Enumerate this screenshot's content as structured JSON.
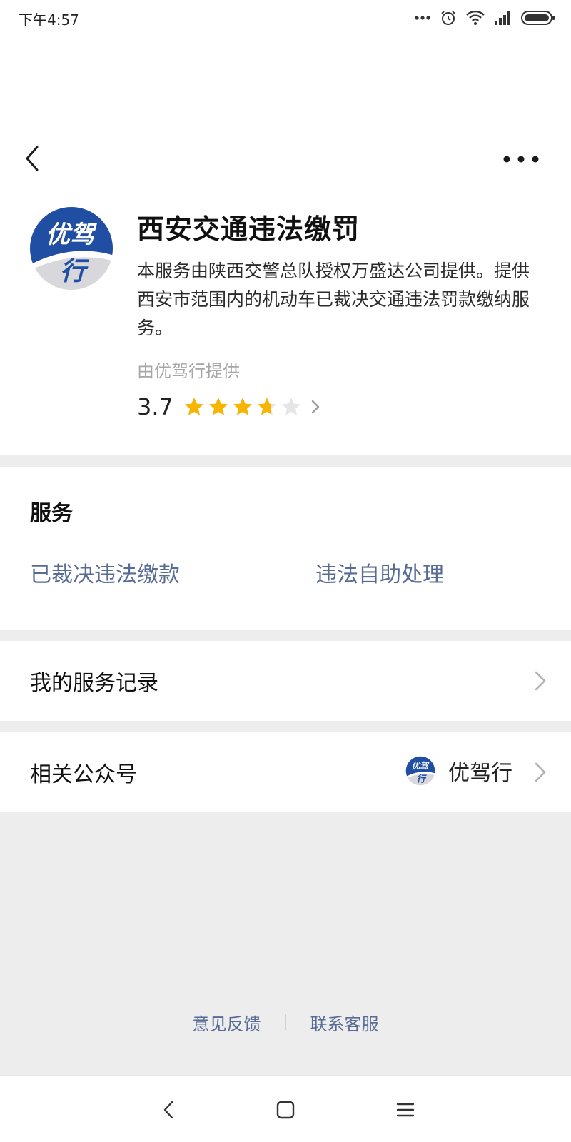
{
  "status_bar": {
    "time": "下午4:57"
  },
  "app": {
    "title": "西安交通违法缴罚",
    "description": "本服务由陕西交警总队授权万盛达公司提供。提供西安市范围内的机动车已裁决交通违法罚款缴纳服务。",
    "provider": "由优驾行提供",
    "rating": "3.7",
    "rating_stars": 3.7,
    "logo_text_top": "优驾",
    "logo_text_bottom": "行"
  },
  "services": {
    "heading": "服务",
    "items": [
      {
        "label": "已裁决违法缴款"
      },
      {
        "label": "违法自助处理"
      }
    ]
  },
  "records": {
    "label": "我的服务记录"
  },
  "related": {
    "label": "相关公众号",
    "account_name": "优驾行"
  },
  "footer": {
    "feedback": "意见反馈",
    "contact": "联系客服"
  },
  "colors": {
    "link": "#576b95",
    "star": "#f7b500",
    "star_empty": "#e5e5e5",
    "logo_blue": "#1f4ea3"
  }
}
